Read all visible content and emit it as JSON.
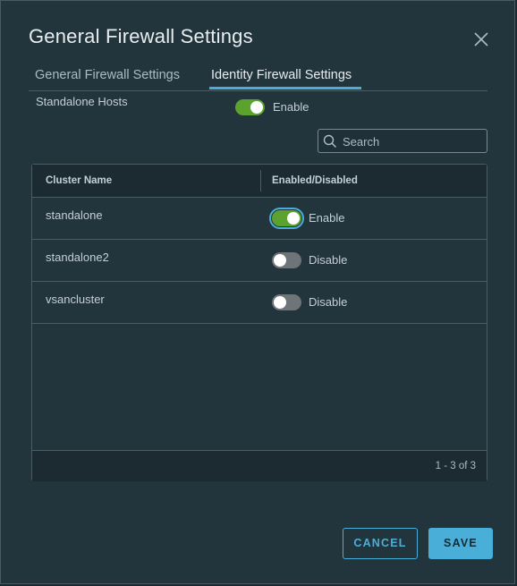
{
  "dialog": {
    "title": "General Firewall Settings"
  },
  "tabs": [
    {
      "label": "General Firewall Settings",
      "active": false
    },
    {
      "label": "Identity Firewall Settings",
      "active": true
    }
  ],
  "standalone_hosts": {
    "label": "Standalone Hosts",
    "toggle_on": true,
    "toggle_text": "Enable"
  },
  "search": {
    "placeholder": "Search",
    "value": ""
  },
  "grid": {
    "columns": [
      "Cluster Name",
      "Enabled/Disabled"
    ],
    "rows": [
      {
        "name": "standalone",
        "enabled": true,
        "status": "Enable"
      },
      {
        "name": "standalone2",
        "enabled": false,
        "status": "Disable"
      },
      {
        "name": "vsancluster",
        "enabled": false,
        "status": "Disable"
      }
    ],
    "pagination": "1 - 3 of 3"
  },
  "buttons": {
    "cancel": "CANCEL",
    "save": "SAVE"
  },
  "colors": {
    "accent": "#49afd9",
    "toggle_on": "#5ba22e",
    "toggle_off": "#6e7478",
    "background": "#22343c"
  },
  "icons": {
    "close": "close-icon",
    "search": "search-icon"
  }
}
